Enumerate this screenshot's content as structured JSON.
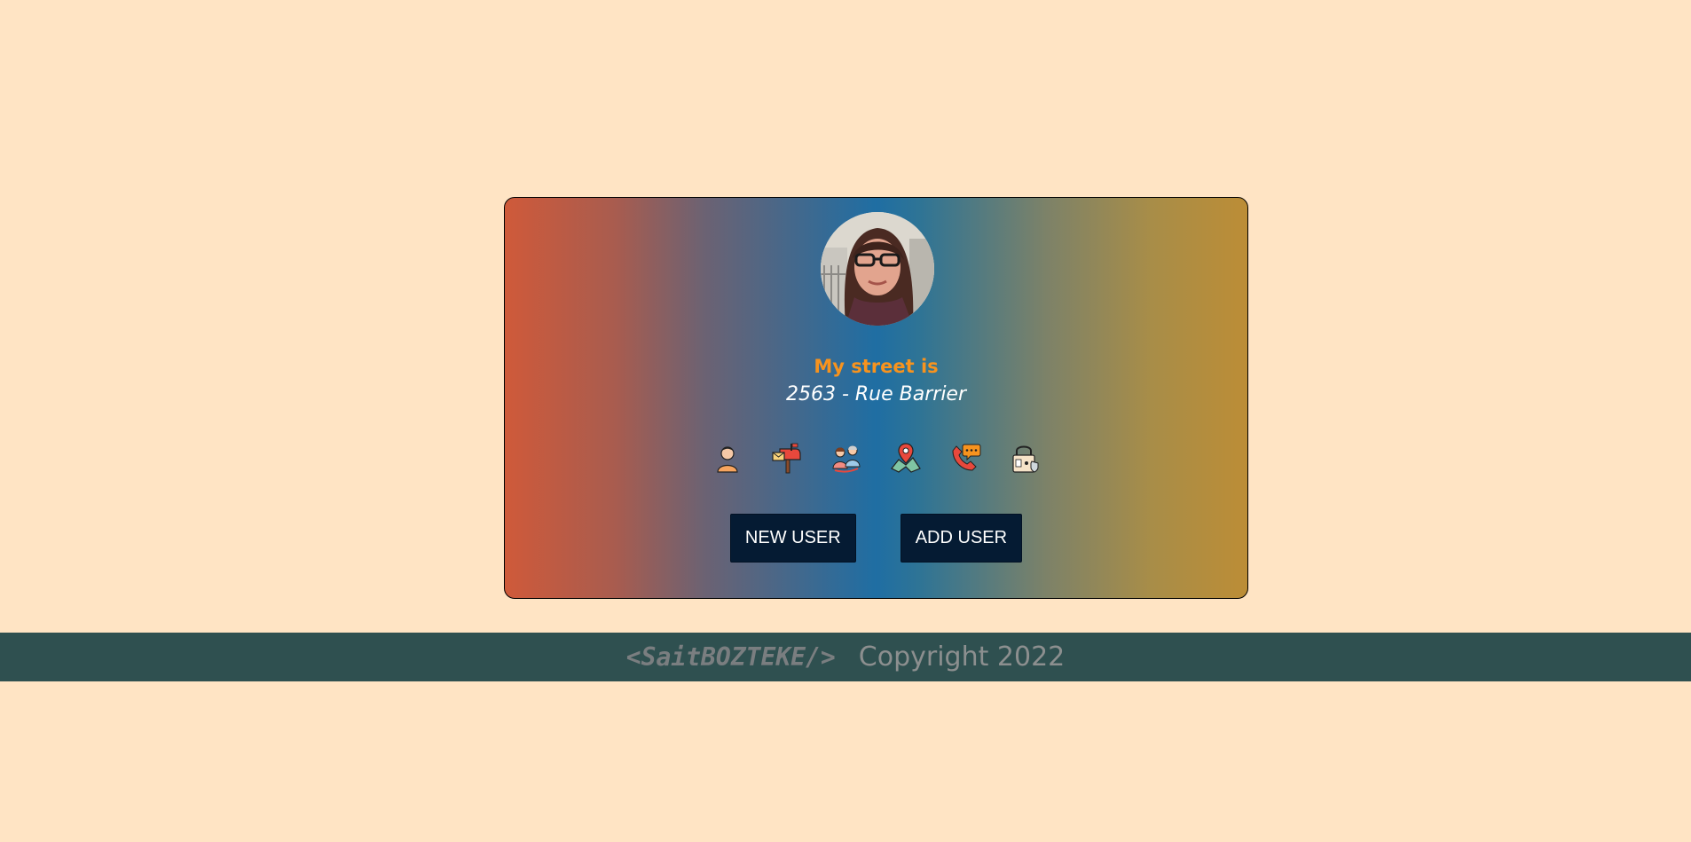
{
  "card": {
    "label": "My street is",
    "value": "2563 - Rue Barrier"
  },
  "avatar": {
    "alt": "user-photo"
  },
  "icons": [
    {
      "name": "user-icon"
    },
    {
      "name": "mailbox-icon"
    },
    {
      "name": "age-icon"
    },
    {
      "name": "map-location-icon"
    },
    {
      "name": "phone-icon"
    },
    {
      "name": "lock-icon"
    }
  ],
  "buttons": {
    "new_user": "NEW USER",
    "add_user": "ADD USER"
  },
  "footer": {
    "brand": "<SaitBOZTEKE/>",
    "copyright": "Copyright 2022"
  },
  "colors": {
    "background": "#ffe4c4",
    "label": "#f7931e",
    "button": "#051b33",
    "footer": "#2f5050"
  }
}
